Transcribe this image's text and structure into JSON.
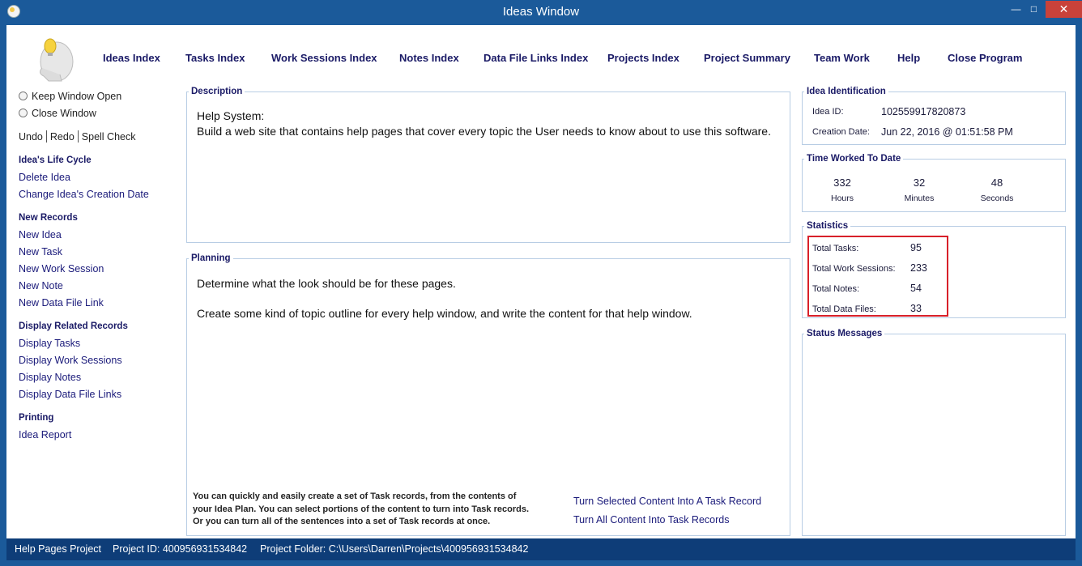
{
  "window": {
    "title": "Ideas Window"
  },
  "menu": [
    {
      "label": "Ideas Index"
    },
    {
      "label": "Tasks Index"
    },
    {
      "label": "Work Sessions Index"
    },
    {
      "label": "Notes Index"
    },
    {
      "label": "Data File Links Index"
    },
    {
      "label": "Projects Index"
    },
    {
      "label": "Project Summary"
    },
    {
      "label": "Team Work"
    },
    {
      "label": "Help"
    },
    {
      "label": "Close Program"
    }
  ],
  "sidebar": {
    "keep_open": "Keep Window Open",
    "close_window": "Close Window",
    "undo": "Undo",
    "redo": "Redo",
    "spell_check": "Spell Check",
    "sections": [
      {
        "title": "Idea's Life Cycle",
        "items": [
          "Delete Idea",
          "Change Idea's Creation Date"
        ]
      },
      {
        "title": "New Records",
        "items": [
          "New Idea",
          "New Task",
          "New Work Session",
          "New Note",
          "New Data File Link"
        ]
      },
      {
        "title": "Display Related Records",
        "items": [
          "Display Tasks",
          "Display Work Sessions",
          "Display Notes",
          "Display Data File Links"
        ]
      },
      {
        "title": "Printing",
        "items": [
          "Idea Report"
        ]
      }
    ]
  },
  "description": {
    "title": "Description",
    "lines": [
      "Help System:",
      "Build a web site that contains help pages that cover every topic the User needs to know about to use this software."
    ]
  },
  "planning": {
    "title": "Planning",
    "lines": [
      "Determine what the look should be for these pages.",
      "Create some kind of topic outline for every help window, and write the content for that help window."
    ],
    "hint_lines": [
      "You can quickly and easily create a set of Task records, from the contents of",
      "your Idea Plan. You can select portions of the content to turn into Task records.",
      "Or you can turn all of the sentences into a set of Task records at once."
    ],
    "convert_selected": "Turn Selected Content Into A Task Record",
    "convert_all": "Turn All Content Into Task Records"
  },
  "identification": {
    "title": "Idea Identification",
    "id_label": "Idea ID:",
    "id_value": "102559917820873",
    "date_label": "Creation Date:",
    "date_value": "Jun  22, 2016 @ 01:51:58 PM"
  },
  "time_worked": {
    "title": "Time Worked To Date",
    "hours": "332",
    "hours_label": "Hours",
    "minutes": "32",
    "minutes_label": "Minutes",
    "seconds": "48",
    "seconds_label": "Seconds"
  },
  "statistics": {
    "title": "Statistics",
    "rows": [
      {
        "label": "Total Tasks:",
        "value": "95"
      },
      {
        "label": "Total Work Sessions:",
        "value": "233"
      },
      {
        "label": "Total Notes:",
        "value": "54"
      },
      {
        "label": "Total Data Files:",
        "value": "33"
      }
    ]
  },
  "status_messages": {
    "title": "Status Messages"
  },
  "statusbar": {
    "project": "Help Pages Project",
    "project_id": "Project ID:  400956931534842",
    "project_folder": "Project Folder: C:\\Users\\Darren\\Projects\\400956931534842"
  },
  "colors": {
    "accent": "#1b5a9a",
    "statusbar": "#0e3d78",
    "highlight": "#d8202a",
    "link": "#1a1a7a"
  }
}
